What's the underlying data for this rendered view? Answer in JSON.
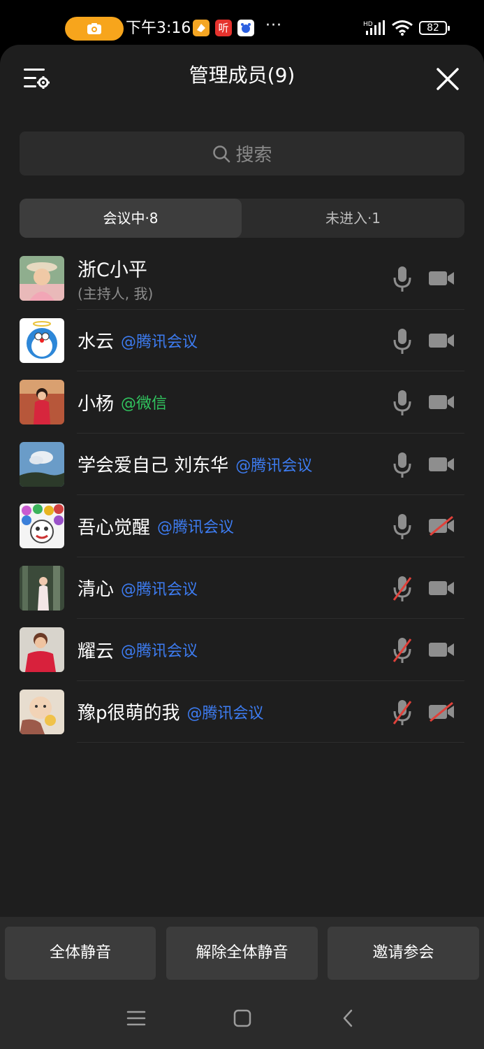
{
  "status_bar": {
    "time": "下午3:16",
    "more": "···",
    "battery": "82",
    "network_badge": "HD",
    "app_badge_ting": "听"
  },
  "header": {
    "title": "管理成员(9)"
  },
  "search": {
    "placeholder": "搜索"
  },
  "tabs": [
    {
      "label": "会议中·8"
    },
    {
      "label": "未进入·1"
    }
  ],
  "members": [
    {
      "name": "浙C小平",
      "subtitle": "(主持人, 我)",
      "mic": "on",
      "camera": "on"
    },
    {
      "name": "水云",
      "platform": "@腾讯会议",
      "platform_color": "#3d7cf1",
      "mic": "on",
      "camera": "on"
    },
    {
      "name": "小杨",
      "platform": "@微信",
      "platform_color": "#31c55f",
      "mic": "on",
      "camera": "on"
    },
    {
      "name": "学会爱自己 刘东华",
      "platform": "@腾讯会议",
      "platform_color": "#3d7cf1",
      "mic": "on",
      "camera": "on"
    },
    {
      "name": "吾心觉醒",
      "platform": "@腾讯会议",
      "platform_color": "#3d7cf1",
      "mic": "on",
      "camera": "off"
    },
    {
      "name": "清心",
      "platform": "@腾讯会议",
      "platform_color": "#3d7cf1",
      "mic": "off",
      "camera": "on"
    },
    {
      "name": "耀云",
      "platform": "@腾讯会议",
      "platform_color": "#3d7cf1",
      "mic": "off",
      "camera": "on"
    },
    {
      "name": "豫p很萌的我",
      "platform": "@腾讯会议",
      "platform_color": "#3d7cf1",
      "mic": "off",
      "camera": "off"
    }
  ],
  "actions": {
    "mute_all": "全体静音",
    "unmute_all": "解除全体静音",
    "invite": "邀请参会"
  },
  "colors": {
    "sheet_bg": "#1e1e1e",
    "accent_blue": "#3d7cf1",
    "wechat_green": "#31c55f",
    "muted_red": "#e0413a",
    "icon_gray": "#8e8e8e"
  }
}
